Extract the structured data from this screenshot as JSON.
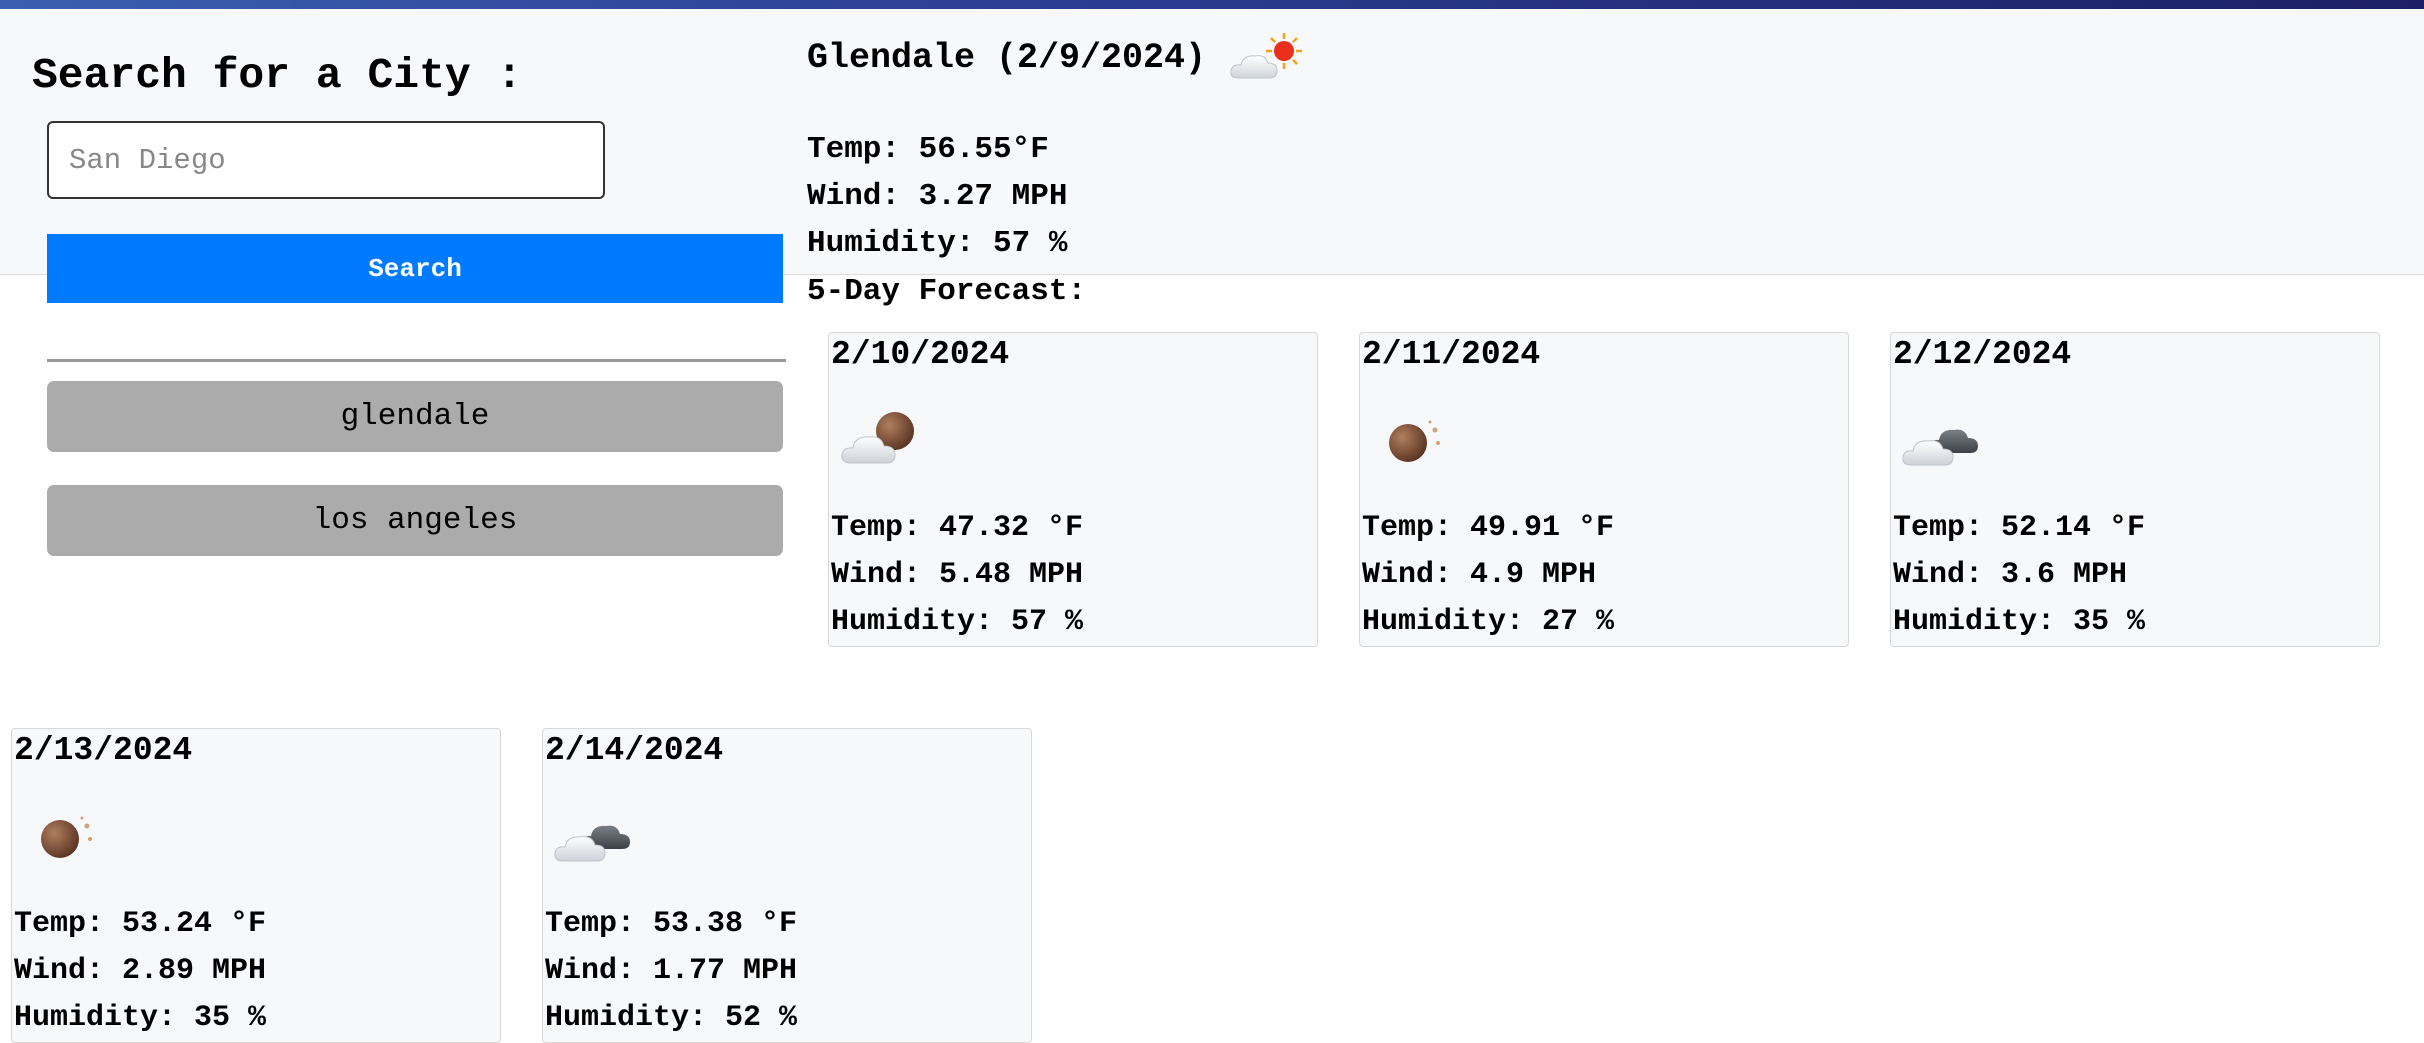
{
  "search": {
    "title": "Search for a City :",
    "placeholder": "San Diego",
    "button_label": "Search"
  },
  "history": [
    {
      "label": "glendale"
    },
    {
      "label": "los angeles"
    }
  ],
  "current": {
    "title": "Glendale (2/9/2024)",
    "icon": "few-clouds-day-icon",
    "temp": "Temp: 56.55°F",
    "wind": "Wind: 3.27 MPH",
    "humidity": "Humidity: 57 %"
  },
  "forecast": {
    "heading": "5-Day Forecast:",
    "days": [
      {
        "date": "2/10/2024",
        "icon": "few-clouds-night-icon",
        "temp": "Temp: 47.32 °F",
        "wind": "Wind: 5.48 MPH",
        "humidity": "Humidity: 57 %"
      },
      {
        "date": "2/11/2024",
        "icon": "clear-night-icon",
        "temp": "Temp: 49.91 °F",
        "wind": "Wind: 4.9 MPH",
        "humidity": "Humidity: 27 %"
      },
      {
        "date": "2/12/2024",
        "icon": "broken-clouds-icon",
        "temp": "Temp: 52.14 °F",
        "wind": "Wind: 3.6 MPH",
        "humidity": "Humidity: 35 %"
      },
      {
        "date": "2/13/2024",
        "icon": "clear-night-icon",
        "temp": "Temp: 53.24 °F",
        "wind": "Wind: 2.89 MPH",
        "humidity": "Humidity: 35 %"
      },
      {
        "date": "2/14/2024",
        "icon": "broken-clouds-icon",
        "temp": "Temp: 53.38 °F",
        "wind": "Wind: 1.77 MPH",
        "humidity": "Humidity: 52 %"
      }
    ]
  },
  "colors": {
    "accent": "#007bff",
    "history_button": "#ababab",
    "card_background": "#f7f8fa"
  }
}
